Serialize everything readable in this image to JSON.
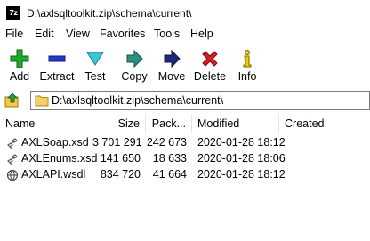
{
  "window": {
    "app_icon_text": "7z",
    "title": "D:\\axlsqltoolkit.zip\\schema\\current\\"
  },
  "menu": [
    "File",
    "Edit",
    "View",
    "Favorites",
    "Tools",
    "Help"
  ],
  "toolbar": [
    {
      "label": "Add",
      "icon": "add-icon",
      "color": "#1fa32a"
    },
    {
      "label": "Extract",
      "icon": "extract-icon",
      "color": "#1e36c8"
    },
    {
      "label": "Test",
      "icon": "test-icon",
      "color": "#2fb8c8"
    },
    {
      "label": "Copy",
      "icon": "copy-icon",
      "color": "#2e8f7e"
    },
    {
      "label": "Move",
      "icon": "move-icon",
      "color": "#1b2a7a"
    },
    {
      "label": "Delete",
      "icon": "delete-icon",
      "color": "#d42020"
    },
    {
      "label": "Info",
      "icon": "info-icon",
      "color": "#e8c400"
    }
  ],
  "address": {
    "path": "D:\\axlsqltoolkit.zip\\schema\\current\\"
  },
  "columns": {
    "name": "Name",
    "size": "Size",
    "packed": "Pack...",
    "modified": "Modified",
    "created": "Created"
  },
  "files": [
    {
      "name": "AXLSoap.xsd",
      "size": "3 701 291",
      "packed": "242 673",
      "modified": "2020-01-28 18:12",
      "icon": "xsd-file-icon"
    },
    {
      "name": "AXLEnums.xsd",
      "size": "141 650",
      "packed": "18 633",
      "modified": "2020-01-28 18:06",
      "icon": "xsd-file-icon"
    },
    {
      "name": "AXLAPI.wsdl",
      "size": "834 720",
      "packed": "41 664",
      "modified": "2020-01-28 18:12",
      "icon": "wsdl-file-icon"
    }
  ]
}
